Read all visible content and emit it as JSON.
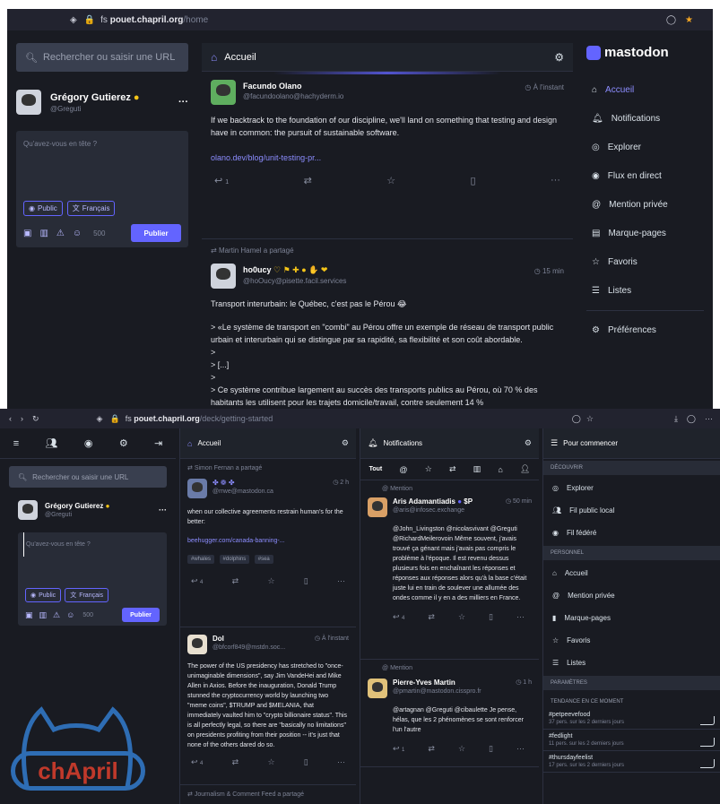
{
  "top": {
    "url_prefix": "fs",
    "url_host": "pouet.chapril.org",
    "url_path": "/home",
    "search_placeholder": "Rechercher ou saisir une URL",
    "profile": {
      "name": "Grégory Gutierez",
      "handle": "@Greguti"
    },
    "compose": {
      "placeholder": "Qu'avez-vous en tête ?",
      "visibility": "Public",
      "language": "Français",
      "counter": "500",
      "publish": "Publier"
    },
    "column_title": "Accueil",
    "posts": [
      {
        "author": "Facundo Olano",
        "handle": "@facundoolano@hachyderm.io",
        "time": "À l'instant",
        "text": "If we backtrack to the foundation of our discipline, we'll land on something that testing and design have in common: the pursuit of sustainable software.",
        "link": "olano.dev/blog/unit-testing-pr...",
        "replies": "1"
      },
      {
        "boosted_by": "Martin Hamel a partagé",
        "author": "ho0ucy",
        "handle": "@hoOucy@pisette.facil.services",
        "time": "15 min",
        "lines": [
          "Transport interurbain: le Québec, c'est pas le Pérou 😂",
          "> «Le système de transport en \"combi\" au Pérou offre un exemple de réseau de transport public urbain et interurbain qui se distingue par sa rapidité, sa flexibilité et son coût abordable.",
          ">",
          "> [...]",
          ">",
          "> Ce système contribue largement au succès des transports publics au Pérou, où 70 % des habitants les utilisent pour les trajets domicile/travail, contre seulement 14 %"
        ]
      }
    ],
    "brand": "mastodon",
    "nav": [
      "Accueil",
      "Notifications",
      "Explorer",
      "Flux en direct",
      "Mention privée",
      "Marque-pages",
      "Favoris",
      "Listes"
    ],
    "preferences": "Préférences"
  },
  "bottom": {
    "url_prefix": "fs",
    "url_host": "pouet.chapril.org",
    "url_path": "/deck/getting-started",
    "search_placeholder": "Rechercher ou saisir une URL",
    "profile": {
      "name": "Grégory Gutierez",
      "handle": "@Greguti"
    },
    "compose": {
      "placeholder": "Qu'avez-vous en tête ?",
      "visibility": "Public",
      "language": "Français",
      "counter": "500",
      "publish": "Publier"
    },
    "home": {
      "title": "Accueil",
      "boost": "Simon Fernan a partagé",
      "post1": {
        "handle": "@rrwe@mastodon.ca",
        "time": "2 h",
        "text": "when our collective agreements restrain human's for the better:",
        "link": "beehugger.com/canada-banning-...",
        "tags": [
          "#whales",
          "#dolphins",
          "#sea"
        ],
        "replies": "4"
      },
      "post2": {
        "author": "Dol",
        "handle": "@bfcorf849@mstdn.soc...",
        "time": "À l'instant",
        "text": "The power of the US presidency has stretched to \"once-unimaginable dimensions\", say Jim VandeHei and Mike Allen in Axios. Before the inauguration, Donald Trump stunned the cryptocurrency world by launching two \"meme coins\", $TRUMP and $MELANIA, that immediately vaulted him to \"crypto billionaire status\". This is all perfectly legal, so there are \"basically no limitations\" on presidents profiting from their position -- it's just that none of the others dared do so.",
        "replies": "4"
      },
      "footer": "Journalism & Comment Feed a partagé"
    },
    "notifications": {
      "title": "Notifications",
      "tab_all": "Tout",
      "mention_label": "Mention",
      "n1": {
        "author": "Aris Adamantiadis",
        "badges": "$P",
        "time": "50 min",
        "handle": "@aris@infosec.exchange",
        "text": "@John_Livingston @nicolasvivant @Greguti @RichardMeilerovoin Même souvent, j'avais trouvé ça génant mais j'avais pas compris le problème à l'époque. Il est revenu dessus plusieurs fois en enchaînant les réponses et réponses aux réponses alors qu'à la base c'était juste lui en train de soulever une allumée des ondes comme il y en a des milliers en France.",
        "replies": "4"
      },
      "n2": {
        "author": "Pierre-Yves Martin",
        "time": "1 h",
        "handle": "@pmartin@mastodon.cisspro.fr",
        "text": "@artagnan @Greguti @cibaulette Je pense, hélas, que les 2 phénomènes se sont renforcer l'un l'autre",
        "replies": "1"
      }
    },
    "start": {
      "title": "Pour commencer",
      "discover": "DÉCOUVRIR",
      "discover_items": [
        "Explorer",
        "Fil public local",
        "Fil fédéré"
      ],
      "personal": "PERSONNEL",
      "personal_items": [
        "Accueil",
        "Mention privée",
        "Marque-pages",
        "Favoris",
        "Listes"
      ],
      "params": "PARAMÈTRES",
      "trending": "TENDANCE EN CE MOMENT",
      "trends": [
        {
          "tag": "#petpeevefood",
          "count": "37 pers. sur les 2 derniers jours"
        },
        {
          "tag": "#fedlight",
          "count": "11 pers. sur les 2 derniers jours"
        },
        {
          "tag": "#thursdayfeelist",
          "count": "17 pers. sur les 2 derniers jours"
        }
      ]
    },
    "logo": "chApril"
  }
}
